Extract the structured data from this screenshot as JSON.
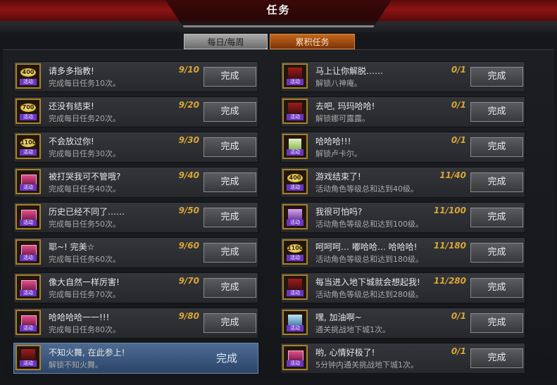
{
  "header": {
    "title": "任务"
  },
  "tabs": {
    "daily": "每日/每周",
    "cumulative": "累积任务"
  },
  "left_tasks": [
    {
      "name": "请多多指教!",
      "desc": "完成每日任务10次。",
      "progress": "9/10",
      "button": "完成",
      "icon": "coin",
      "icon_value": "400",
      "icon_tag": "活动"
    },
    {
      "name": "还没有结束!",
      "desc": "完成每日任务20次。",
      "progress": "9/20",
      "button": "完成",
      "icon": "coin",
      "icon_value": "700",
      "icon_tag": "活动"
    },
    {
      "name": "不会放过你!",
      "desc": "完成每日任务30次。",
      "progress": "9/30",
      "button": "完成",
      "icon": "coin",
      "icon_value": "1100",
      "icon_tag": "活动"
    },
    {
      "name": "被打哭我可不管哦?",
      "desc": "完成每日任务40次。",
      "progress": "9/40",
      "button": "完成",
      "icon": "card",
      "icon_value": "",
      "icon_tag": "活动"
    },
    {
      "name": "历史已经不同了……",
      "desc": "完成每日任务50次。",
      "progress": "9/50",
      "button": "完成",
      "icon": "card",
      "icon_value": "",
      "icon_tag": "活动"
    },
    {
      "name": "耶~! 完美☆",
      "desc": "完成每日任务60次。",
      "progress": "9/60",
      "button": "完成",
      "icon": "card",
      "icon_value": "",
      "icon_tag": "活动"
    },
    {
      "name": "像大自然一样厉害!",
      "desc": "完成每日任务70次。",
      "progress": "9/70",
      "button": "完成",
      "icon": "card",
      "icon_value": "",
      "icon_tag": "活动"
    },
    {
      "name": "哈哈哈哈一一!!!",
      "desc": "完成每日任务80次。",
      "progress": "9/80",
      "button": "完成",
      "icon": "card",
      "icon_value": "",
      "icon_tag": "活动"
    },
    {
      "name": "不知火舞, 在此参上!",
      "desc": "解锁不知火舞。",
      "progress": "",
      "button": "完成",
      "icon": "portrait",
      "icon_value": "",
      "icon_tag": "活动"
    }
  ],
  "right_tasks": [
    {
      "name": "马上让你解脱……",
      "desc": "解锁八神庵。",
      "progress": "0/1",
      "button": "完成",
      "icon": "portrait",
      "icon_value": "",
      "icon_tag": "活动"
    },
    {
      "name": "去吧, 玛玛哈哈!",
      "desc": "解锁娜可露露。",
      "progress": "0/1",
      "button": "完成",
      "icon": "portrait",
      "icon_value": "",
      "icon_tag": "活动"
    },
    {
      "name": "哈哈哈!!!",
      "desc": "解锁卢卡尔。",
      "progress": "0/1",
      "button": "完成",
      "icon": "gift",
      "icon_value": "",
      "icon_tag": "活动"
    },
    {
      "name": "游戏结束了!",
      "desc": "活动角色等级总和达到40级。",
      "progress": "11/40",
      "button": "完成",
      "icon": "coin",
      "icon_value": "400",
      "icon_tag": "活动"
    },
    {
      "name": "我很可怕吗?",
      "desc": "活动角色等级总和达到100级。",
      "progress": "11/100",
      "button": "完成",
      "icon": "purple",
      "icon_value": "",
      "icon_tag": "活动"
    },
    {
      "name": "呵呵呵… 嘟哈哈… 哈哈哈!",
      "desc": "活动角色等级总和达到180级。",
      "progress": "11/180",
      "button": "完成",
      "icon": "coin",
      "icon_value": "1100",
      "icon_tag": "活动"
    },
    {
      "name": "每当进入地下城就会想起我!",
      "desc": "活动角色等级总和达到280级。",
      "progress": "11/280",
      "button": "完成",
      "icon": "portrait",
      "icon_value": "",
      "icon_tag": "活动"
    },
    {
      "name": "嘿, 加油啊~",
      "desc": "通关挑战地下城1次。",
      "progress": "0/1",
      "button": "完成",
      "icon": "blue",
      "icon_value": "",
      "icon_tag": "活动"
    },
    {
      "name": "哟, 心情好极了!",
      "desc": "5分钟内通关挑战地下城1次。",
      "progress": "0/1",
      "button": "完成",
      "icon": "card",
      "icon_value": "",
      "icon_tag": "活动"
    }
  ],
  "highlighted_left_index": 8
}
